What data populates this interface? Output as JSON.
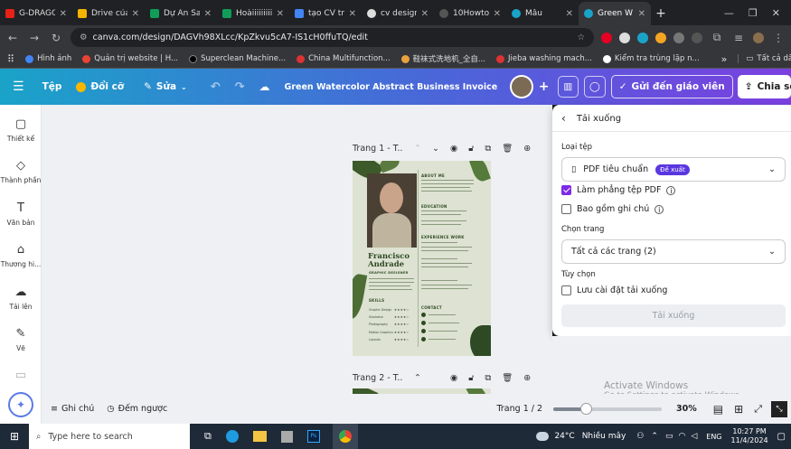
{
  "browser": {
    "tabs": [
      {
        "label": "G-DRAGO",
        "color": "#e62117"
      },
      {
        "label": "Drive của",
        "color": "#f4b400"
      },
      {
        "label": "Dự Án Sa",
        "color": "#0f9d58"
      },
      {
        "label": "Hoàiiiiiiiii",
        "color": "#0f9d58"
      },
      {
        "label": "tạo CV tr",
        "color": "#4285f4"
      },
      {
        "label": "cv design",
        "color": "#dddddd"
      },
      {
        "label": "10Howto",
        "color": "#555555"
      },
      {
        "label": "Mẫu",
        "color": "#1aa3c9"
      },
      {
        "label": "Green W",
        "color": "#1aa3c9"
      }
    ],
    "new_tab": "+",
    "url": "canva.com/design/DAGVh98XLcc/KpZkvu5cA7-IS1cH0ffuTQ/edit",
    "bookmarks": [
      "Hình ảnh",
      "Quản trị website | H...",
      "Superclean Machine...",
      "China Multifunction...",
      "鞋袜式洗地机_全自...",
      "Jieba washing mach...",
      "Kiểm tra trùng lặp n..."
    ],
    "bookmarks_more": "»",
    "all_bookmarks": "Tất cả dấu trang"
  },
  "canva": {
    "file_menu": "Tệp",
    "resize": "Đổi cỡ",
    "edit": "Sửa",
    "doc_title": "Green Watercolor Abstract Business Invoice",
    "send_teacher": "Gửi đến giáo viên",
    "share": "Chia sẻ"
  },
  "sidebar": {
    "items": [
      "Thiết kế",
      "Thành phần",
      "Văn bản",
      "Thương hi...",
      "Tải lên",
      "Vẽ"
    ]
  },
  "canvas": {
    "page1_label": "Trang 1 - T...",
    "page2_label": "Trang 2 - T..."
  },
  "resume": {
    "first_name": "Francisco",
    "last_name": "Andrade",
    "role": "GRAPHIC DESIGNER",
    "about": "ABOUT ME",
    "education": "EDUCATION",
    "experience": "EXPERIENCE WORK",
    "skills": "SKILLS",
    "contact": "CONTACT",
    "skill_names": [
      "Graphic Design",
      "Illustrator",
      "Photography",
      "Motion Graphics",
      "Layouts"
    ]
  },
  "download_panel": {
    "title": "Tải xuống",
    "file_type_label": "Loại tệp",
    "file_type_value": "PDF tiêu chuẩn",
    "recommended_badge": "Đề xuất",
    "flatten_label": "Làm phẳng tệp PDF",
    "flatten_checked": true,
    "notes_label": "Bao gồm ghi chú",
    "notes_checked": false,
    "pages_label": "Chọn trang",
    "pages_value": "Tất cả các trang (2)",
    "options_label": "Tùy chọn",
    "save_settings_label": "Lưu cài đặt tải xuống",
    "save_settings_checked": false,
    "download_button": "Tải xuống"
  },
  "bottom": {
    "notes": "Ghi chú",
    "timer": "Đếm ngược",
    "page_counter": "Trang 1 / 2",
    "zoom": "30%",
    "zoom_fraction": 0.3
  },
  "watermark": {
    "line1": "Activate Windows",
    "line2": "Go to Settings to activate Windows."
  },
  "taskbar": {
    "search_placeholder": "Type here to search",
    "weather_temp": "24°C",
    "weather_desc": "Nhiều mây",
    "lang": "ENG",
    "time": "10:27 PM",
    "date": "11/4/2024"
  },
  "colors": {
    "accent": "#7d2ae8",
    "resume_green": "#2d4a22",
    "resume_bg": "#dde2d2"
  }
}
